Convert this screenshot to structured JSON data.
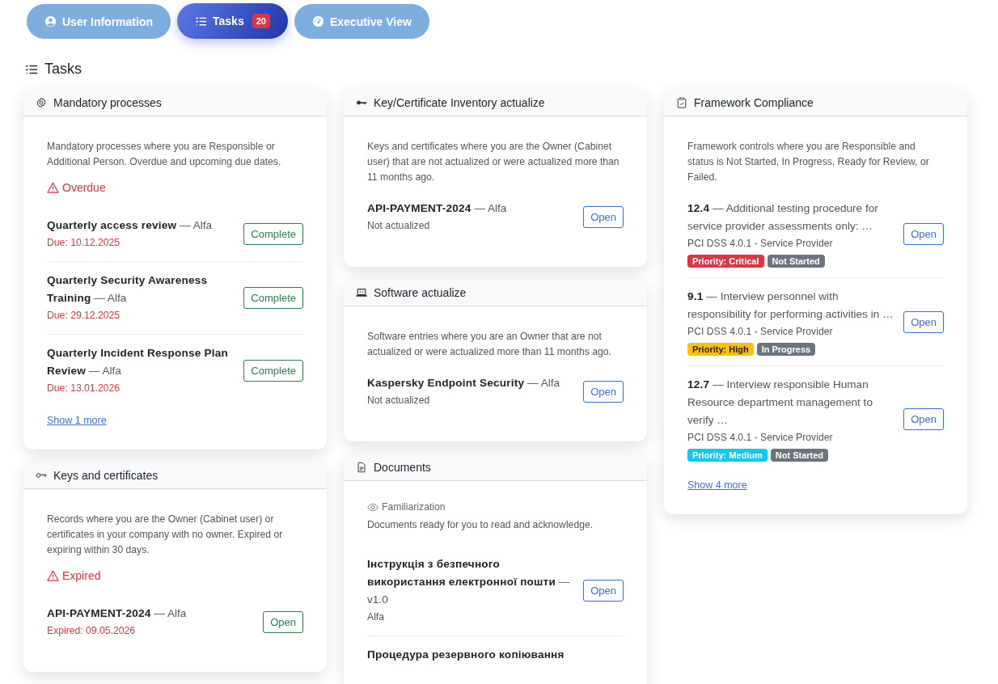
{
  "tabs": [
    {
      "label": "User Information",
      "selected": false
    },
    {
      "label": "Tasks",
      "badge": "20",
      "selected": true
    },
    {
      "label": "Executive View",
      "selected": false
    }
  ],
  "heading": "Tasks",
  "columns": [
    {
      "cards": [
        {
          "title": "Mandatory processes",
          "description": "Mandatory processes where you are Responsible or Additional Person. Overdue and upcoming due dates.",
          "section": {
            "kind": "alert",
            "label": "Overdue"
          },
          "items": [
            {
              "title": "**Quarterly access review** — Alfa",
              "lines": [
                {
                  "kind": "due",
                  "text": "Due: 10.12.2025"
                }
              ],
              "button": {
                "kind": "success",
                "label": "Complete"
              }
            },
            {
              "title": "**Quarterly Security Awareness Training** — Alfa",
              "lines": [
                {
                  "kind": "due",
                  "text": "Due: 29.12.2025"
                }
              ],
              "button": {
                "kind": "success",
                "label": "Complete"
              }
            },
            {
              "title": "**Quarterly Incident Response Plan Review** — Alfa",
              "lines": [
                {
                  "kind": "due",
                  "text": "Due: 13.01.2026"
                }
              ],
              "button": {
                "kind": "success",
                "label": "Complete"
              }
            }
          ],
          "more": "Show 1 more"
        },
        {
          "title": "Keys and certificates",
          "description": "Records where you are the Owner (Cabinet user) or certificates in your company with no owner. Expired or expiring within 30 days.",
          "section": {
            "kind": "alert",
            "label": "Expired"
          },
          "items": [
            {
              "title": "**API-PAYMENT-2024** — Alfa",
              "lines": [
                {
                  "kind": "due",
                  "text": "Expired: 09.05.2026"
                }
              ],
              "button": {
                "kind": "success",
                "label": "Open"
              }
            }
          ]
        }
      ]
    },
    {
      "cards": [
        {
          "title": "Key/Certificate Inventory actualize",
          "description": "Keys and certificates where you are the Owner (Cabinet user) that are not actualized or were actualized more than 11 months ago.",
          "items": [
            {
              "title": "**API-PAYMENT-2024** — Alfa",
              "lines": [
                {
                  "kind": "note",
                  "text": "Not actualized"
                }
              ],
              "button": {
                "kind": "primary",
                "label": "Open"
              }
            }
          ]
        },
        {
          "title": "Software actualize",
          "description": "Software entries where you are an Owner that are not actualized or were actualized more than 11 months ago.",
          "items": [
            {
              "title": "**Kaspersky Endpoint Security** — Alfa",
              "lines": [
                {
                  "kind": "note",
                  "text": "Not actualized"
                }
              ],
              "button": {
                "kind": "primary",
                "label": "Open"
              }
            }
          ]
        },
        {
          "title": "Documents",
          "section": {
            "kind": "info",
            "label": "Familiarization"
          },
          "description": "Documents ready for you to read and acknowledge.",
          "items": [
            {
              "title": "**Інструкція з безпечного використання електронної пошти** — v1.0",
              "lines": [
                {
                  "kind": "note",
                  "text": "Alfa"
                }
              ],
              "button": {
                "kind": "primary",
                "label": "Open"
              }
            },
            {
              "title": "**Процедура резервного копіювання**"
            }
          ]
        }
      ]
    },
    {
      "cards": [
        {
          "title": "Framework Compliance",
          "description": "Framework controls where you are Responsible and status is Not Started, In Progress, Ready for Review, or Failed.",
          "items": [
            {
              "title": "**12.4** — Additional testing procedure for service provider assessments only: …",
              "lines": [
                {
                  "kind": "note",
                  "text": "PCI DSS 4.0.1 - Service Provider"
                }
              ],
              "badges": [
                {
                  "text": "Priority: Critical",
                  "color": "#dc3545"
                },
                {
                  "text": "Not Started",
                  "color": "#6c757d"
                }
              ],
              "button": {
                "kind": "primary",
                "label": "Open"
              }
            },
            {
              "title": "**9.1** — Interview personnel with responsibility for performing activities in …",
              "lines": [
                {
                  "kind": "note",
                  "text": "PCI DSS 4.0.1 - Service Provider"
                }
              ],
              "badges": [
                {
                  "text": "Priority: High",
                  "color": "#ffc107"
                },
                {
                  "text": "In Progress",
                  "color": "#6c757d"
                }
              ],
              "button": {
                "kind": "primary",
                "label": "Open"
              }
            },
            {
              "title": "**12.7** — Interview responsible Human Resource department management to verify …",
              "lines": [
                {
                  "kind": "note",
                  "text": "PCI DSS 4.0.1 - Service Provider"
                }
              ],
              "badges": [
                {
                  "text": "Priority: Medium",
                  "color": "#0dcaf0"
                },
                {
                  "text": "Not Started",
                  "color": "#6c757d"
                }
              ],
              "button": {
                "kind": "primary",
                "label": "Open"
              }
            }
          ],
          "more": "Show 4 more"
        }
      ]
    }
  ]
}
